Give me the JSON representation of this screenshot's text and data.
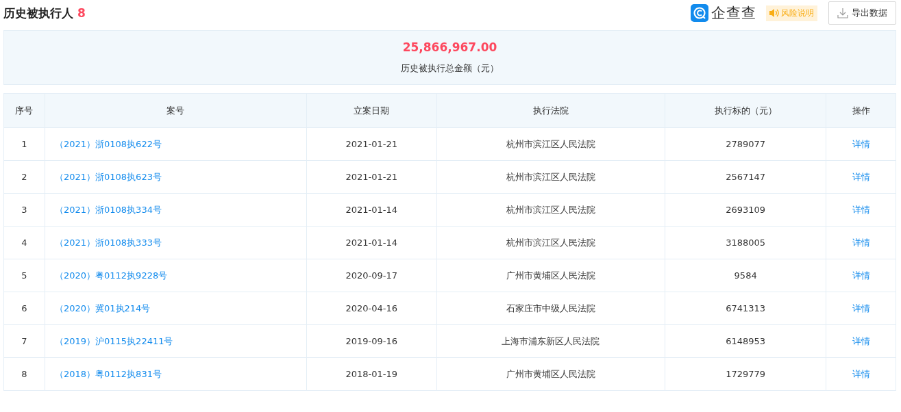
{
  "header": {
    "title": "历史被执行人",
    "count": "8",
    "logo_text": "企查查",
    "risk_label": "风险说明",
    "export_label": "导出数据"
  },
  "summary": {
    "amount": "25,866,967.00",
    "label": "历史被执行总金额（元）"
  },
  "table": {
    "columns": [
      "序号",
      "案号",
      "立案日期",
      "执行法院",
      "执行标的（元）",
      "操作"
    ],
    "rows": [
      {
        "index": "1",
        "case_no": "（2021）浙0108执622号",
        "date": "2021-01-21",
        "court": "杭州市滨江区人民法院",
        "amount": "2789077",
        "action": "详情"
      },
      {
        "index": "2",
        "case_no": "（2021）浙0108执623号",
        "date": "2021-01-21",
        "court": "杭州市滨江区人民法院",
        "amount": "2567147",
        "action": "详情"
      },
      {
        "index": "3",
        "case_no": "（2021）浙0108执334号",
        "date": "2021-01-14",
        "court": "杭州市滨江区人民法院",
        "amount": "2693109",
        "action": "详情"
      },
      {
        "index": "4",
        "case_no": "（2021）浙0108执333号",
        "date": "2021-01-14",
        "court": "杭州市滨江区人民法院",
        "amount": "3188005",
        "action": "详情"
      },
      {
        "index": "5",
        "case_no": "（2020）粤0112执9228号",
        "date": "2020-09-17",
        "court": "广州市黄埔区人民法院",
        "amount": "9584",
        "action": "详情"
      },
      {
        "index": "6",
        "case_no": "（2020）冀01执214号",
        "date": "2020-04-16",
        "court": "石家庄市中级人民法院",
        "amount": "6741313",
        "action": "详情"
      },
      {
        "index": "7",
        "case_no": "（2019）沪0115执22411号",
        "date": "2019-09-16",
        "court": "上海市浦东新区人民法院",
        "amount": "6148953",
        "action": "详情"
      },
      {
        "index": "8",
        "case_no": "（2018）粤0112执831号",
        "date": "2018-01-19",
        "court": "广州市黄埔区人民法院",
        "amount": "1729779",
        "action": "详情"
      }
    ]
  }
}
